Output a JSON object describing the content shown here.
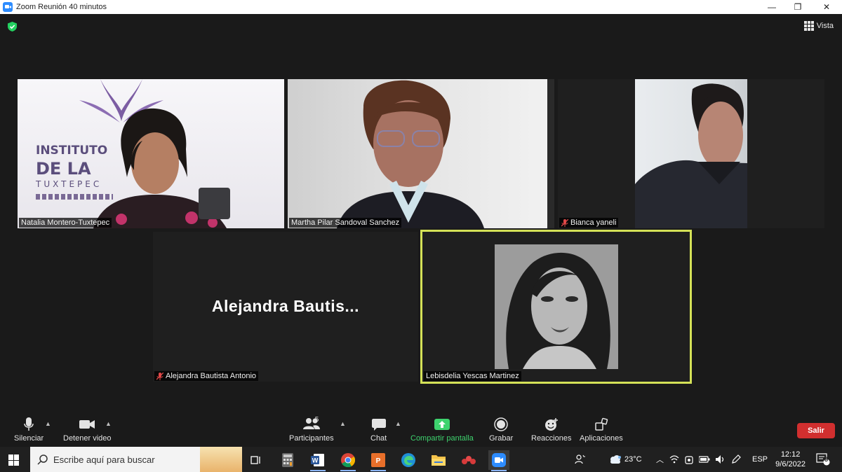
{
  "window": {
    "title": "Zoom Reunión 40 minutos",
    "controls": [
      "—",
      "❐",
      "✕"
    ]
  },
  "meeting": {
    "view_label": "Vista",
    "shield_color": "#23d160"
  },
  "participants": [
    {
      "name": "Natalia Montero-Tuxtepec",
      "muted": false,
      "video": true
    },
    {
      "name": "Martha Pilar Sandoval Sanchez",
      "muted": false,
      "video": true
    },
    {
      "name": "Bianca yaneli",
      "muted": true,
      "video": true
    },
    {
      "name": "Alejandra Bautista Antonio",
      "muted": true,
      "video": false,
      "display_name": "Alejandra  Bautis..."
    },
    {
      "name": "Lebisdelia Yescas Martinez",
      "muted": false,
      "video": true,
      "active_speaker": true
    }
  ],
  "banner": {
    "line1": "INSTITUTO",
    "line2": "DE LA",
    "line3": "TUXTEPEC"
  },
  "toolbar": {
    "mute_label": "Silenciar",
    "video_label": "Detener video",
    "participants_label": "Participantes",
    "participants_count": "5",
    "chat_label": "Chat",
    "share_label": "Compartir pantalla",
    "record_label": "Grabar",
    "reactions_label": "Reacciones",
    "apps_label": "Aplicaciones",
    "leave_label": "Salir",
    "leave_color": "#d12f2f",
    "share_color": "#3ed36e",
    "speaker_border_color": "#d4e157"
  },
  "taskbar": {
    "search_placeholder": "Escribe aquí para buscar",
    "temperature": "23°C",
    "language": "ESP",
    "time": "12:12",
    "date": "9/6/2022",
    "notifications": "8",
    "apps": [
      "task-view-icon",
      "calculator-icon",
      "word-icon",
      "chrome-icon",
      "photoshop-icon",
      "edge-icon",
      "file-explorer-icon",
      "app-red-icon",
      "zoom-icon"
    ]
  }
}
